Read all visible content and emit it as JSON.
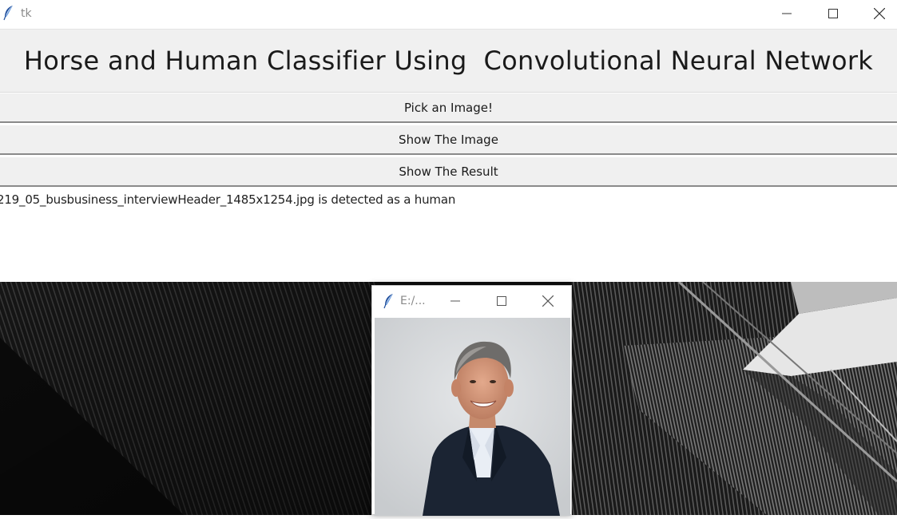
{
  "window": {
    "title": "tk"
  },
  "header": {
    "title": "Horse and Human Classifier Using  Convolutional Neural Network"
  },
  "buttons": {
    "pick": "Pick an Image!",
    "show_image": "Show The Image",
    "show_result": "Show The Result"
  },
  "result": {
    "text": "219_05_busbusiness_interviewHeader_1485x1254.jpg is  detected as a human"
  },
  "popup": {
    "title": "E:/..."
  },
  "icons": {
    "app": "feather-icon",
    "minimize": "minimize-icon",
    "maximize": "maximize-icon",
    "close": "close-icon"
  },
  "colors": {
    "accent": "#1f4e9c",
    "button_bg": "#f0f0f0"
  }
}
